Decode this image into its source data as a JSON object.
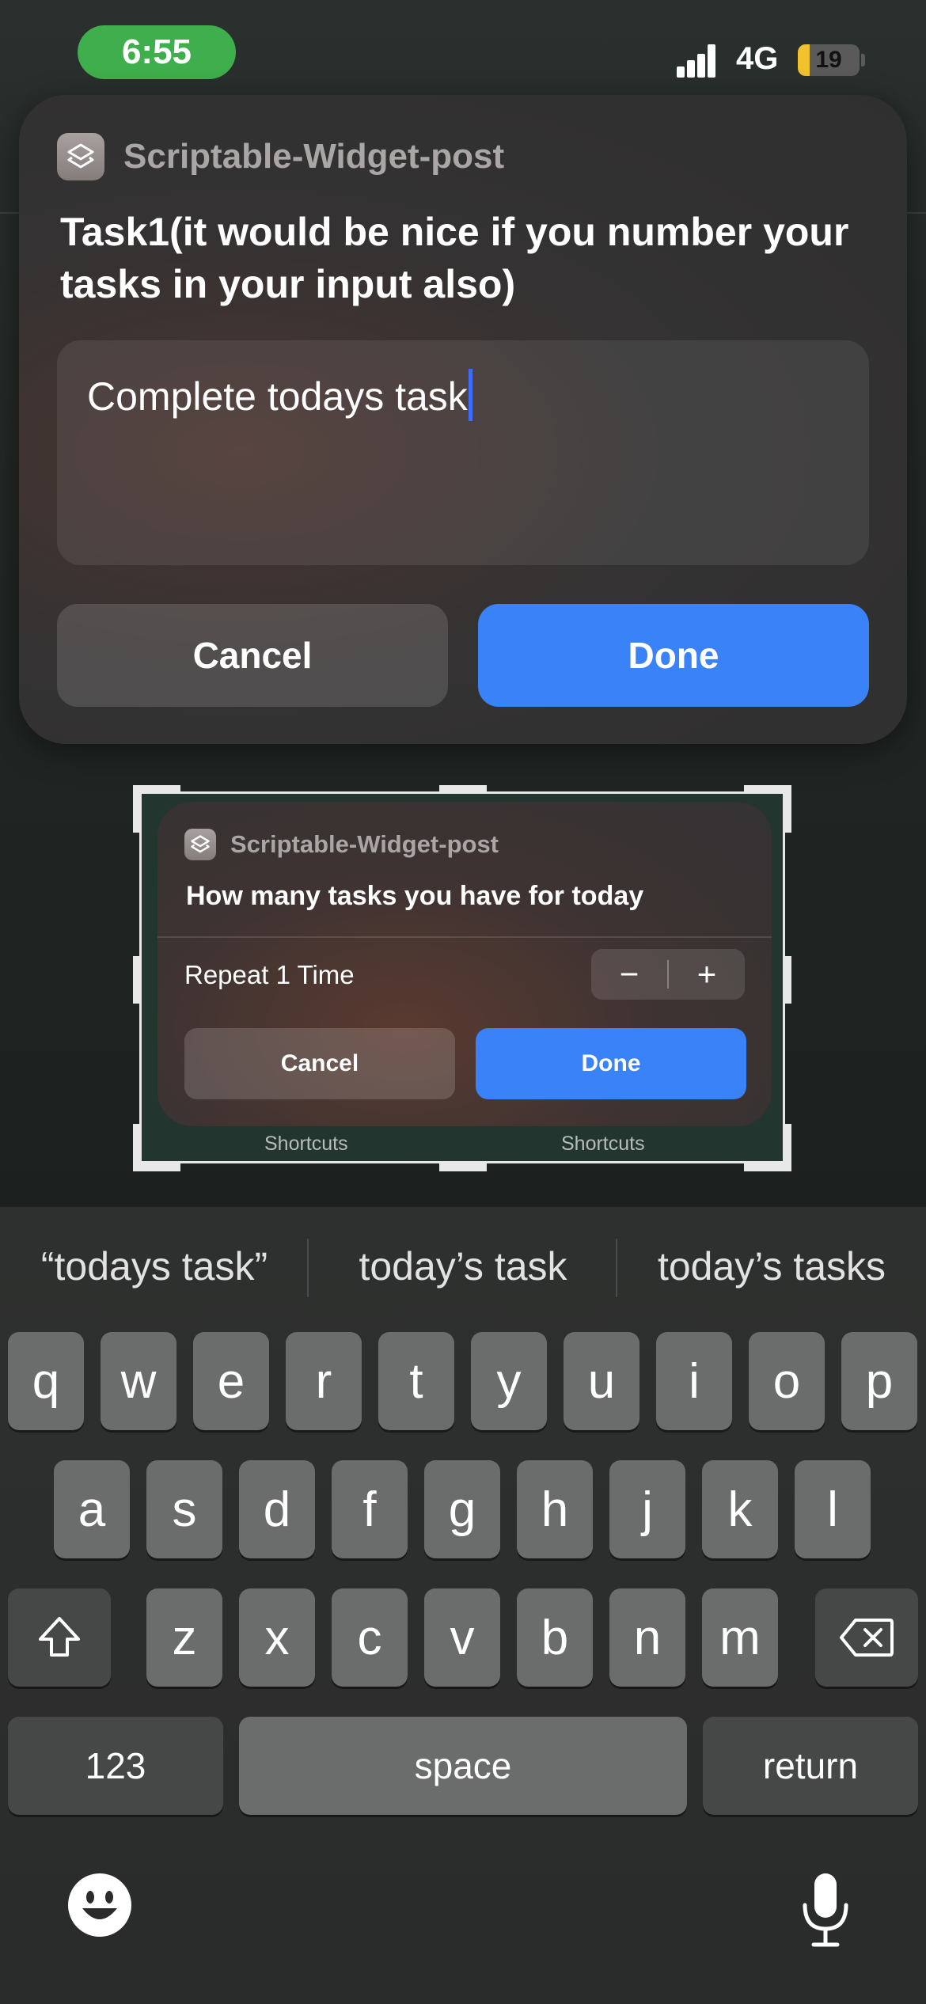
{
  "status_bar": {
    "time": "6:55",
    "network": "4G",
    "battery_percent": "19",
    "battery_level": 0.19,
    "time_pill_color": "#3fae4c",
    "battery_color": "#f2c12e"
  },
  "dialog": {
    "app_name": "Scriptable-Widget-post",
    "app_icon": "shortcuts-icon",
    "prompt": "Task1(it would be nice if you number your tasks in your input also)",
    "input_value": "Complete todays task",
    "cancel_label": "Cancel",
    "done_label": "Done",
    "accent": "#3a82f7"
  },
  "thumbnail": {
    "app_name": "Scriptable-Widget-post",
    "prompt": "How many tasks you have for today",
    "repeat_label": "Repeat 1 Time",
    "stepper_minus": "−",
    "stepper_plus": "+",
    "cancel_label": "Cancel",
    "done_label": "Done",
    "labels": [
      "Shortcuts",
      "Shortcuts"
    ]
  },
  "keyboard": {
    "suggestions": [
      "“todays task”",
      "today’s task",
      "today’s tasks"
    ],
    "row1": [
      "q",
      "w",
      "e",
      "r",
      "t",
      "y",
      "u",
      "i",
      "o",
      "p"
    ],
    "row2": [
      "a",
      "s",
      "d",
      "f",
      "g",
      "h",
      "j",
      "k",
      "l"
    ],
    "row3": [
      "z",
      "x",
      "c",
      "v",
      "b",
      "n",
      "m"
    ],
    "numbers_label": "123",
    "space_label": "space",
    "return_label": "return",
    "shift_icon": "shift-icon",
    "delete_icon": "delete-icon",
    "emoji_icon": "emoji-icon",
    "mic_icon": "microphone-icon"
  }
}
